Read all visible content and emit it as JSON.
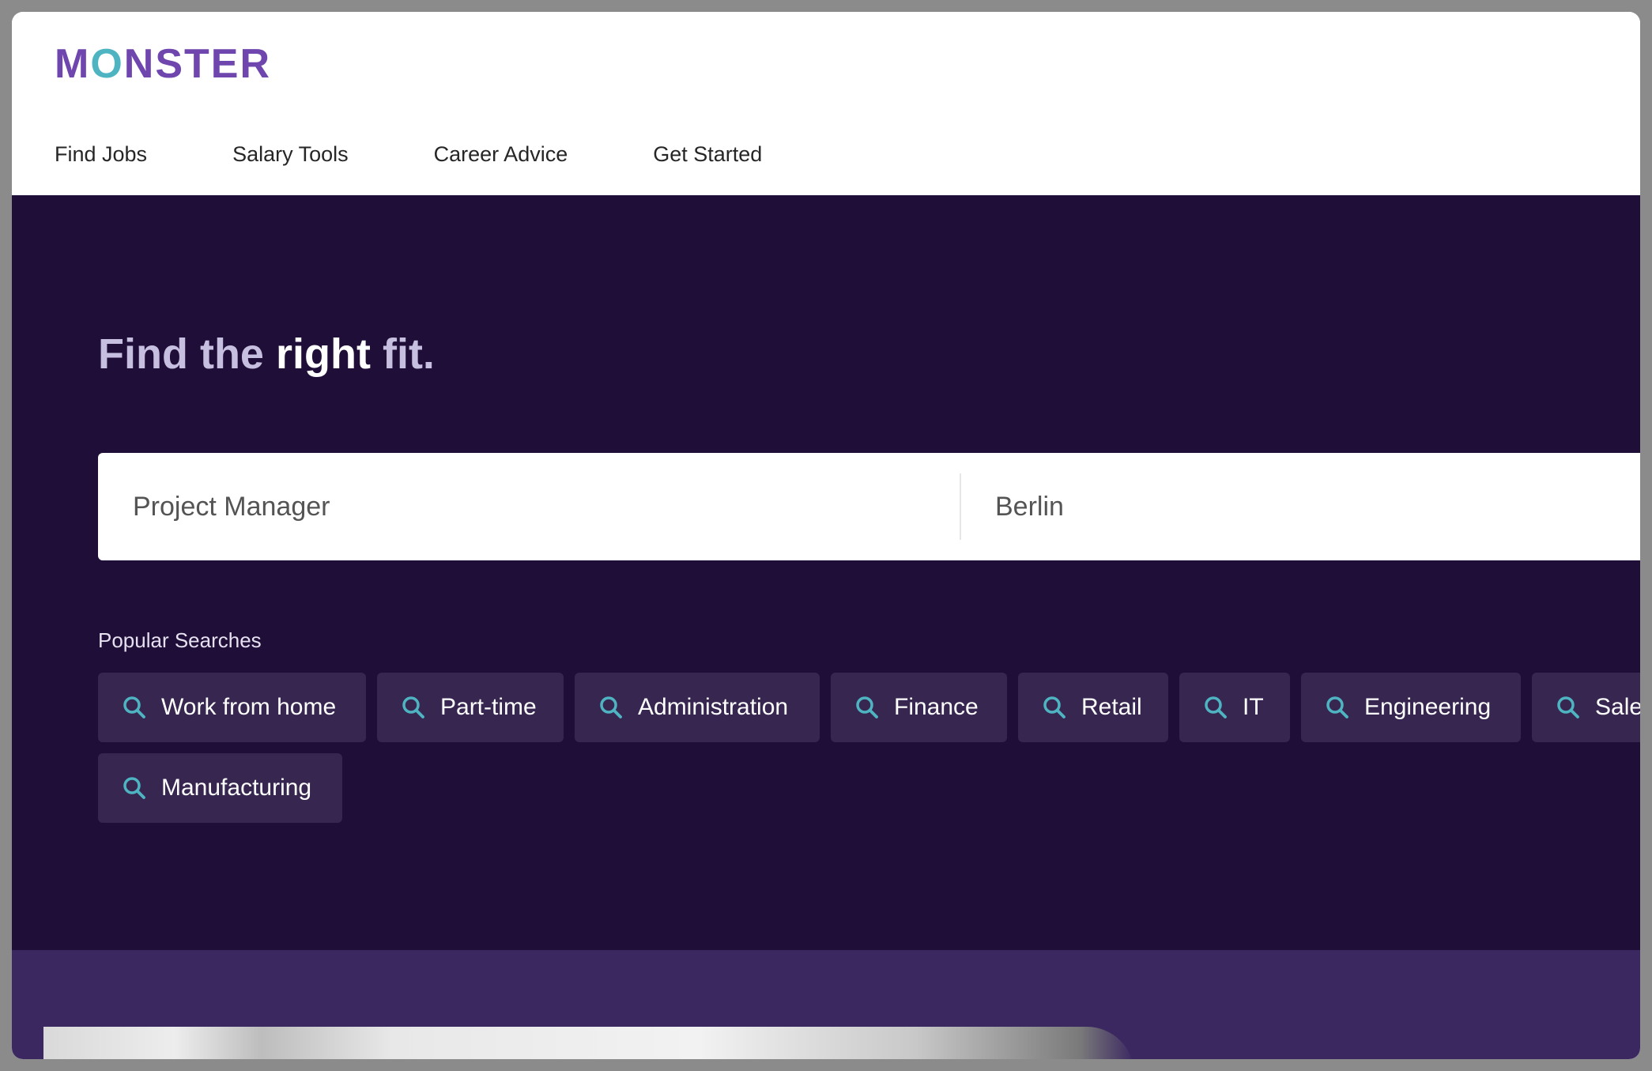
{
  "brand": {
    "logo_text": "MONSTER",
    "logo_color": "#6e46ae",
    "logo_accent_color": "#4fb4c2"
  },
  "nav": {
    "items": [
      {
        "label": "Find Jobs"
      },
      {
        "label": "Salary Tools"
      },
      {
        "label": "Career Advice"
      },
      {
        "label": "Get Started"
      }
    ]
  },
  "hero": {
    "headline_part1": "Find the ",
    "headline_part2": "right",
    "headline_part3": " fit.",
    "background_color": "#1f0e37"
  },
  "search": {
    "what_value": "Project Manager",
    "where_value": "Berlin"
  },
  "popular": {
    "label": "Popular Searches",
    "chips": [
      {
        "label": "Work from home",
        "icon": "search-icon"
      },
      {
        "label": "Part-time",
        "icon": "search-icon"
      },
      {
        "label": "Administration",
        "icon": "search-icon"
      },
      {
        "label": "Finance",
        "icon": "search-icon"
      },
      {
        "label": "Retail",
        "icon": "search-icon"
      },
      {
        "label": "IT",
        "icon": "search-icon"
      },
      {
        "label": "Engineering",
        "icon": "search-icon"
      },
      {
        "label": "Sales",
        "icon": "search-icon"
      },
      {
        "label": "Manufacturing",
        "icon": "search-icon"
      }
    ]
  },
  "colors": {
    "chip_background": "#372650",
    "icon_accent": "#4fb4c2",
    "band_background": "#3b2861"
  }
}
